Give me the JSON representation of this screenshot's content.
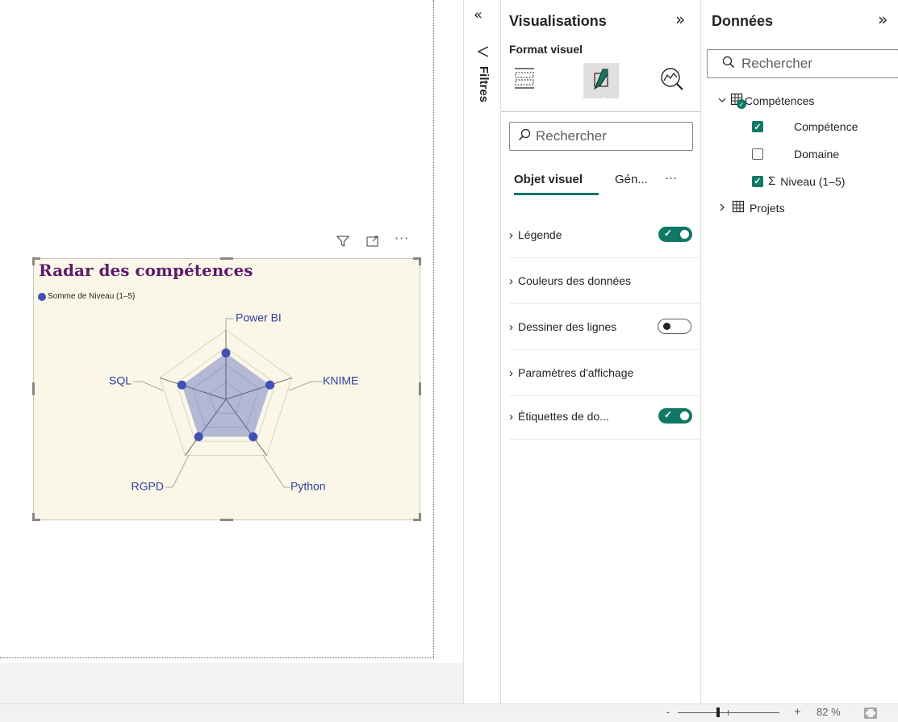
{
  "visual": {
    "title": "Radar des compétences",
    "legend_label": "Somme de Niveau (1–5)",
    "series_color": "#4051b5",
    "title_color": "#5c1a6e",
    "background": "#faf7e8"
  },
  "chart_data": {
    "type": "radar",
    "title": "Radar des compétences",
    "categories": [
      "Power BI",
      "KNIME",
      "Python",
      "RGPD",
      "SQL"
    ],
    "series": [
      {
        "name": "Somme de Niveau (1–5)",
        "values": [
          4,
          4,
          4,
          4,
          4
        ]
      }
    ],
    "rlim": [
      0,
      6
    ],
    "grid": true,
    "legend_position": "top-left"
  },
  "filters": {
    "label": "Filtres"
  },
  "visualisations": {
    "title": "Visualisations",
    "subtitle": "Format visuel",
    "search_placeholder": "Rechercher",
    "tabs": [
      "Objet visuel",
      "Gén...",
      "···"
    ],
    "sections": [
      {
        "label": "Légende",
        "toggle": "on"
      },
      {
        "label": "Couleurs des données",
        "toggle": "none"
      },
      {
        "label": "Dessiner des lignes",
        "toggle": "off"
      },
      {
        "label": "Paramètres d'affichage",
        "toggle": "none"
      },
      {
        "label": "Étiquettes de do...",
        "toggle": "on"
      }
    ]
  },
  "data_pane": {
    "title": "Données",
    "search_placeholder": "Rechercher",
    "tables": [
      {
        "name": "Compétences",
        "expanded": true,
        "fields": [
          {
            "label": "Compétence",
            "checked": true,
            "sigma": false
          },
          {
            "label": "Domaine",
            "checked": false,
            "sigma": false
          },
          {
            "label": "Niveau (1–5)",
            "checked": true,
            "sigma": true
          }
        ]
      },
      {
        "name": "Projets",
        "expanded": false,
        "fields": []
      }
    ]
  },
  "status": {
    "zoom": "82 %",
    "minus": "-",
    "plus": "+"
  },
  "colors": {
    "accent": "#117865"
  }
}
